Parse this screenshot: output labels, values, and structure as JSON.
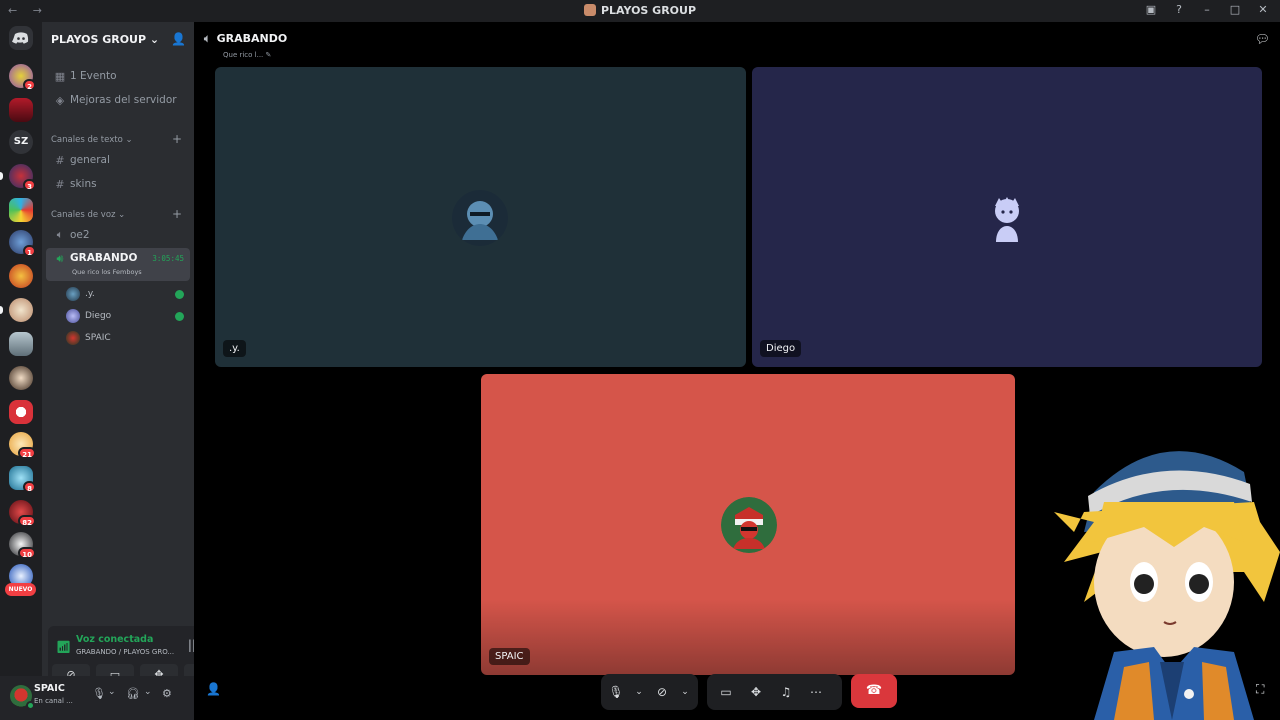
{
  "titlebar": {
    "title": "PLAYOS GROUP",
    "nav": "← →"
  },
  "rail": {
    "badges": [
      "2",
      "3",
      "1",
      "21",
      "8",
      "82",
      "10"
    ],
    "text_server": "SZ",
    "new_label": "NUEVO"
  },
  "sidebar": {
    "guild_name": "PLAYOS GROUP",
    "events": "1 Evento",
    "boosts": "Mejoras del servidor",
    "text_category": "Canales de texto",
    "text_channels": [
      "general",
      "skins"
    ],
    "voice_category": "Canales de voz",
    "voice_channels": [
      "oe2"
    ],
    "active_channel": {
      "name": "GRABANDO",
      "timer": "3:05:45",
      "status": "Que rico los Femboys"
    },
    "members": [
      ".y.",
      "Diego",
      "SPAIC"
    ]
  },
  "voice_panel": {
    "title": "Voz conectada",
    "subtitle": "GRABANDO / PLAYOS GRO..."
  },
  "user": {
    "name": "SPAIC",
    "status": "En canal ..."
  },
  "main": {
    "channel_name": "GRABANDO",
    "channel_status": "Que rico l..."
  },
  "tiles": [
    {
      "name": ".y.",
      "color": "#1f3038"
    },
    {
      "name": "Diego",
      "color": "#25264a"
    },
    {
      "name": "SPAIC",
      "color": "#d5554a"
    }
  ],
  "colors": {
    "accent_green": "#23a559",
    "danger": "#da373c",
    "sidebar_bg": "#2b2d31",
    "rail_bg": "#1e1f22"
  },
  "icons": [
    "discord-icon",
    "speaker-icon",
    "mic-icon",
    "headphones-icon",
    "gear-icon",
    "camera-off-icon",
    "screen-share-icon",
    "activity-icon",
    "soundboard-icon",
    "more-icon",
    "hangup-icon",
    "chat-icon",
    "invite-icon",
    "pencil-icon",
    "popout-icon",
    "fullscreen-icon"
  ]
}
